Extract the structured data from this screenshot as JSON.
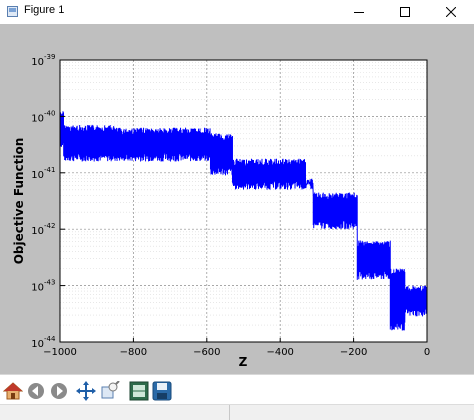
{
  "window": {
    "title": "Figure 1",
    "controls": [
      "minimize",
      "maximize",
      "close"
    ]
  },
  "chart_data": {
    "type": "line",
    "title": "",
    "xlabel": "Z",
    "ylabel": "Objective Function",
    "xlim": [
      -1000,
      0
    ],
    "ylim_exponent": [
      -44,
      -39
    ],
    "yscale": "log",
    "x_ticks": [
      "−1000",
      "−800",
      "−600",
      "−400",
      "−200",
      "0"
    ],
    "y_ticks": [
      {
        "base": "10",
        "exp": "-39"
      },
      {
        "base": "10",
        "exp": "-40"
      },
      {
        "base": "10",
        "exp": "-41"
      },
      {
        "base": "10",
        "exp": "-42"
      },
      {
        "base": "10",
        "exp": "-43"
      },
      {
        "base": "10",
        "exp": "-44"
      }
    ],
    "grid": true,
    "line_color": "#0000ff",
    "series": [
      {
        "segments": [
          {
            "x": [
              -1000,
              -990
            ],
            "low": -40.55,
            "high": -39.9
          },
          {
            "x": [
              -990,
              -850
            ],
            "low": -40.8,
            "high": -40.15
          },
          {
            "x": [
              -850,
              -590
            ],
            "low": -40.8,
            "high": -40.2
          },
          {
            "x": [
              -590,
              -530
            ],
            "low": -41.05,
            "high": -40.3
          },
          {
            "x": [
              -530,
              -330
            ],
            "low": -41.3,
            "high": -40.75
          },
          {
            "x": [
              -330,
              -310
            ],
            "low": -41.3,
            "high": -41.1
          },
          {
            "x": [
              -310,
              -190
            ],
            "low": -42.0,
            "high": -41.35
          },
          {
            "x": [
              -190,
              -100
            ],
            "low": -42.9,
            "high": -42.2
          },
          {
            "x": [
              -100,
              -60
            ],
            "low": -43.8,
            "high": -42.7
          },
          {
            "x": [
              -60,
              0
            ],
            "low": -43.55,
            "high": -43.0
          }
        ]
      }
    ]
  },
  "toolbar": {
    "buttons": [
      {
        "icon": "home-icon",
        "action": "home"
      },
      {
        "icon": "back-icon",
        "action": "back"
      },
      {
        "icon": "forward-icon",
        "action": "forward"
      },
      {
        "icon": "pan-icon",
        "action": "pan"
      },
      {
        "icon": "zoom-icon",
        "action": "zoom"
      },
      {
        "icon": "subplots-icon",
        "action": "configure-subplots"
      },
      {
        "icon": "save-icon",
        "action": "save"
      }
    ]
  },
  "status": {
    "text": ""
  },
  "colors": {
    "figure_background": "#bfbfbf",
    "axes_background": "#ffffff",
    "series": "#0000ff"
  }
}
